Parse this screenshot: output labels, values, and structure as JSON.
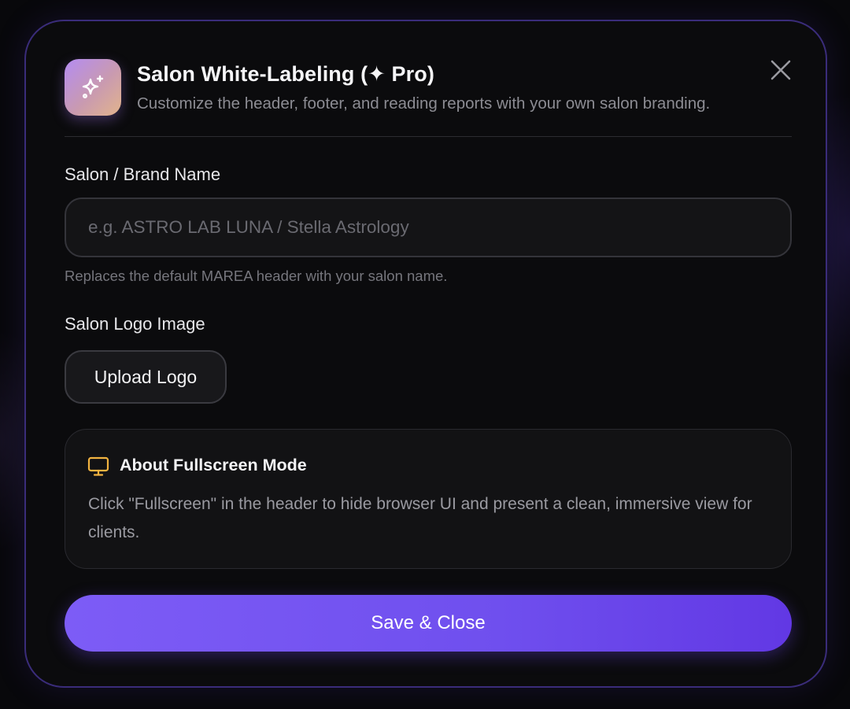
{
  "dialog": {
    "title": "Salon White-Labeling (✦ Pro)",
    "subtitle": "Customize the header, footer, and reading reports with your own salon branding.",
    "icon": "sparkles-icon",
    "close_icon": "close-icon"
  },
  "brand_name": {
    "label": "Salon / Brand Name",
    "value": "",
    "placeholder": "e.g. ASTRO LAB LUNA / Stella Astrology",
    "help": "Replaces the default MAREA header with your salon name."
  },
  "logo": {
    "label": "Salon Logo Image",
    "button_label": "Upload Logo"
  },
  "info": {
    "icon": "monitor-icon",
    "title": "About Fullscreen Mode",
    "body": "Click \"Fullscreen\" in the header to hide browser UI and present a clean, immersive view for clients."
  },
  "actions": {
    "save_label": "Save & Close"
  },
  "colors": {
    "accent": "#7a5af5",
    "modal_border": "#3a2c7a",
    "info_icon": "#f2b340"
  }
}
